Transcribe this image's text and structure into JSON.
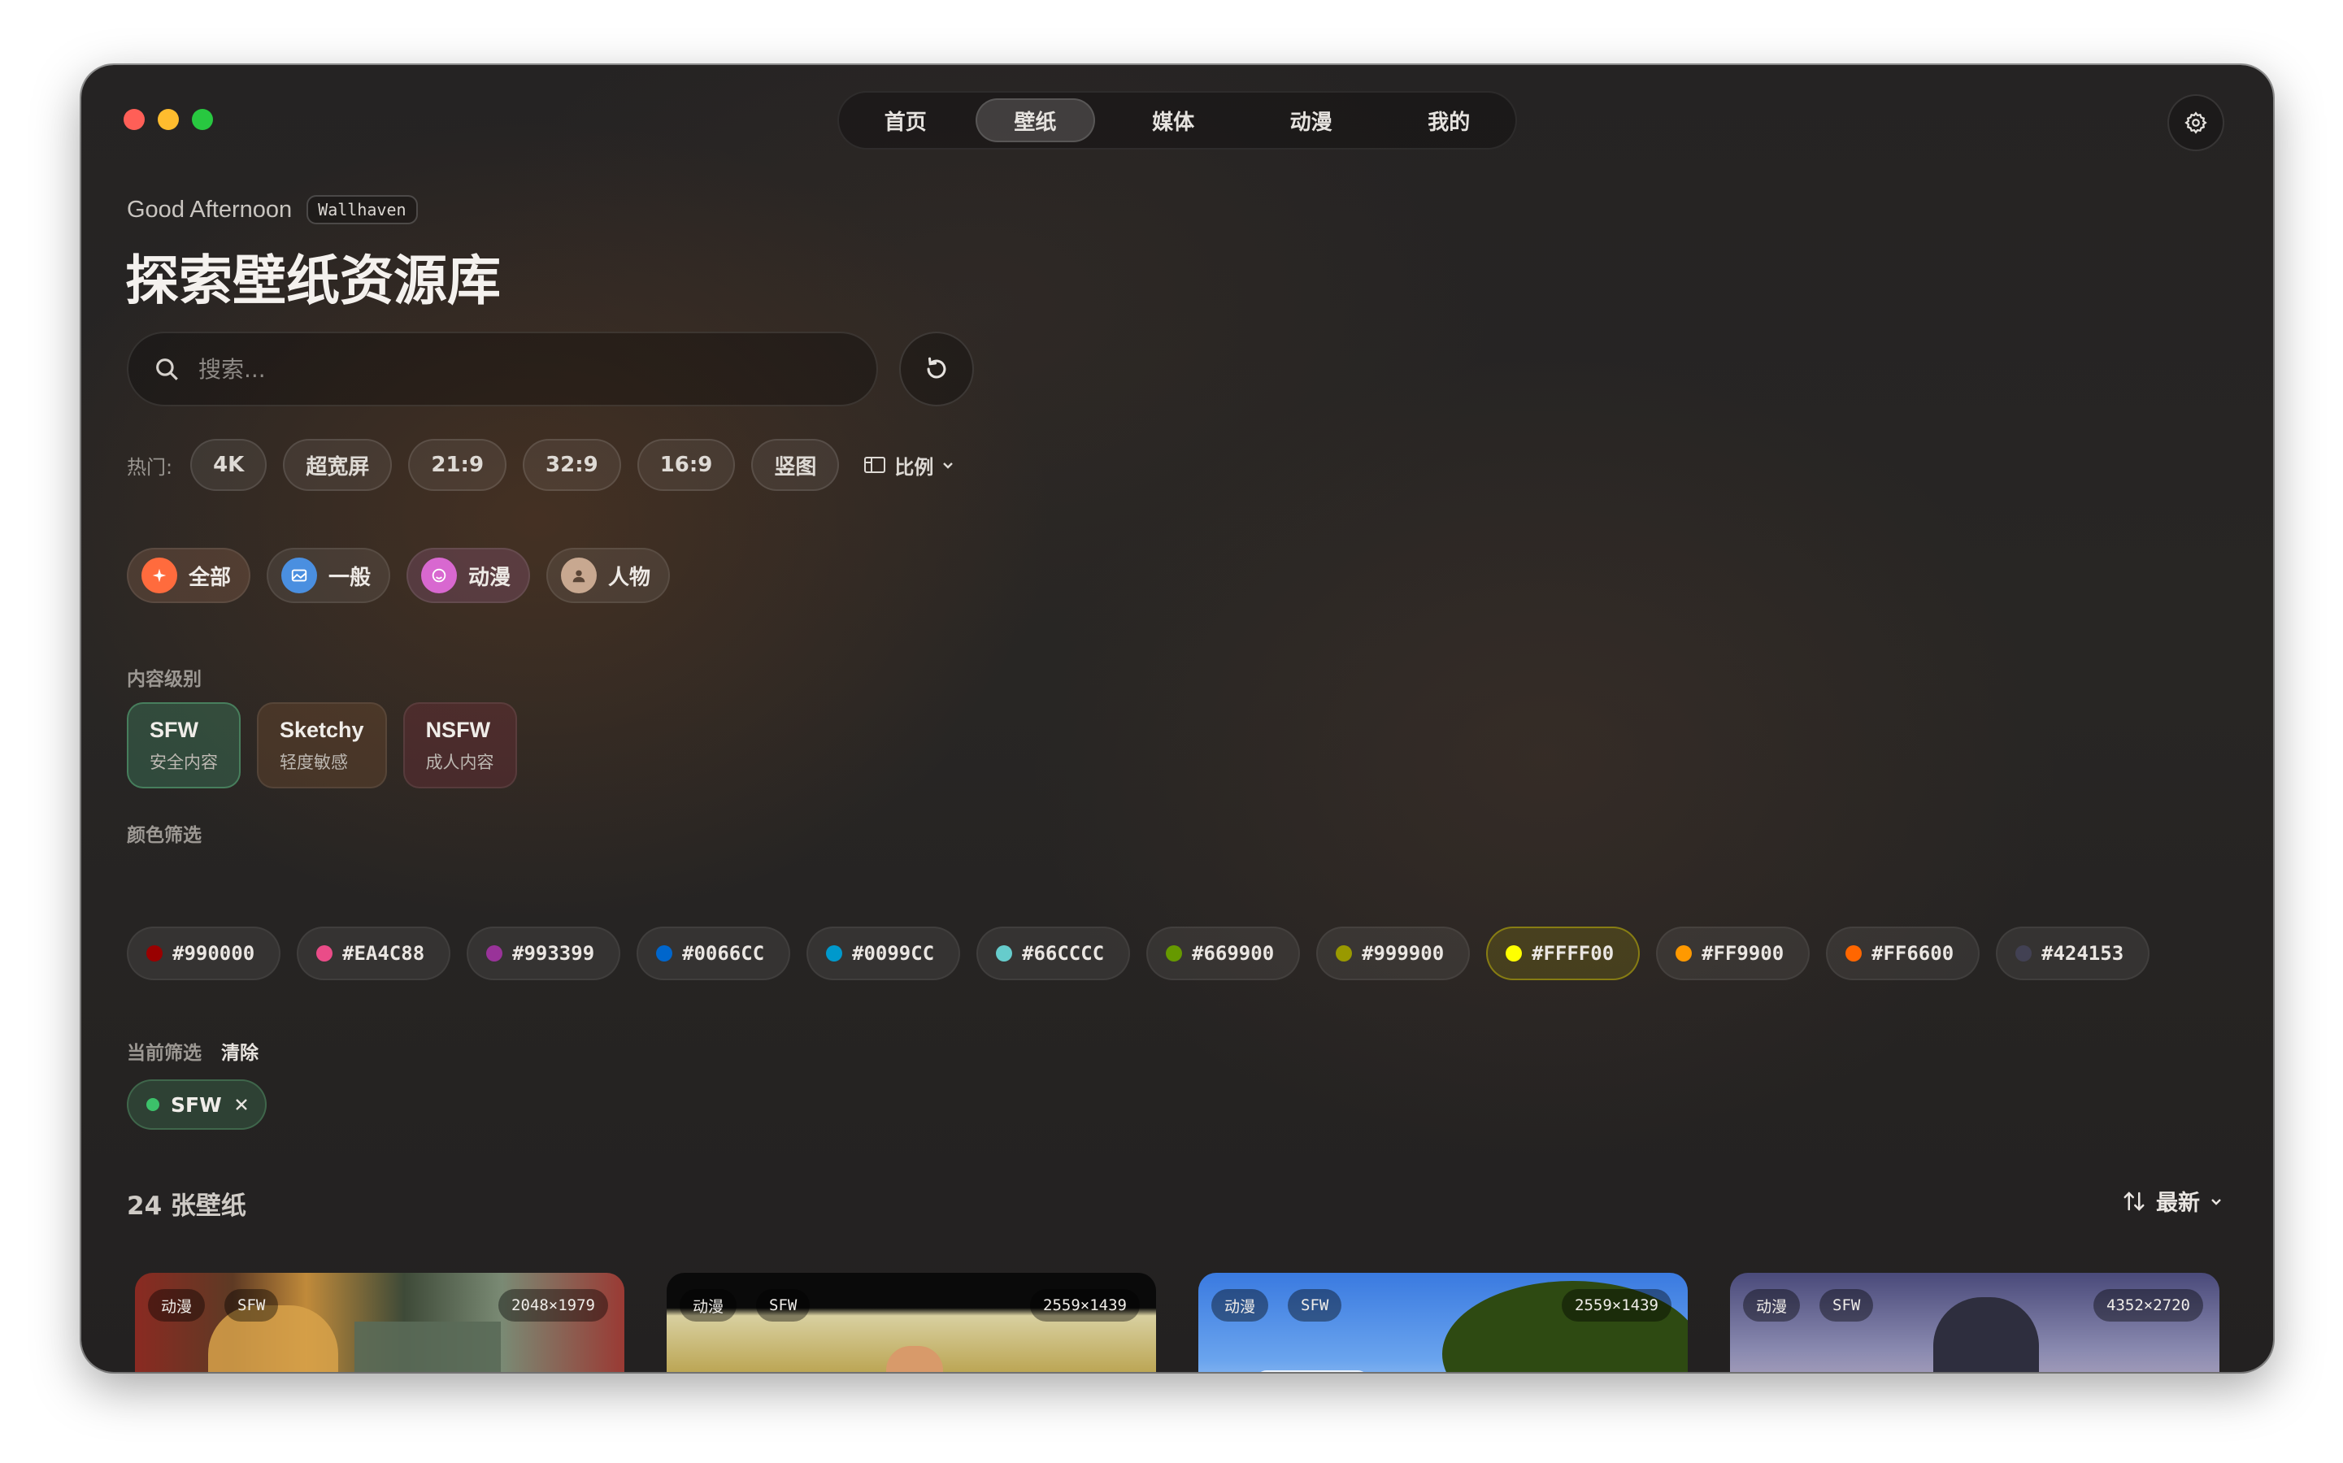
{
  "nav": {
    "tabs": [
      {
        "label": "首页"
      },
      {
        "label": "壁纸"
      },
      {
        "label": "媒体"
      },
      {
        "label": "动漫"
      },
      {
        "label": "我的"
      }
    ],
    "active": "壁纸"
  },
  "header": {
    "greeting": "Good Afternoon",
    "source_badge": "Wallhaven",
    "title": "探索壁纸资源库"
  },
  "search": {
    "placeholder": "搜索..."
  },
  "hot": {
    "label": "热门:",
    "tags": [
      "4K",
      "超宽屏",
      "21:9",
      "32:9",
      "16:9",
      "竖图"
    ],
    "ratio_label": "比例"
  },
  "categories": [
    {
      "label": "全部",
      "icon": "sparkle-icon",
      "color": "#ff6b3d"
    },
    {
      "label": "一般",
      "icon": "image-icon",
      "color": "#4a8fe0"
    },
    {
      "label": "动漫",
      "icon": "smile-icon",
      "color": "#d868d0"
    },
    {
      "label": "人物",
      "icon": "person-icon",
      "color": "#c8a890"
    }
  ],
  "content_level": {
    "label": "内容级别",
    "levels": [
      {
        "title": "SFW",
        "subtitle": "安全内容"
      },
      {
        "title": "Sketchy",
        "subtitle": "轻度敏感"
      },
      {
        "title": "NSFW",
        "subtitle": "成人内容"
      }
    ]
  },
  "color_filter": {
    "label": "颜色筛选",
    "colors": [
      {
        "label": "#990000",
        "hex": "#990000"
      },
      {
        "label": "#EA4C88",
        "hex": "#EA4C88"
      },
      {
        "label": "#993399",
        "hex": "#993399"
      },
      {
        "label": "#0066CC",
        "hex": "#0066CC"
      },
      {
        "label": "#0099CC",
        "hex": "#0099CC"
      },
      {
        "label": "#66CCCC",
        "hex": "#66CCCC"
      },
      {
        "label": "#669900",
        "hex": "#669900"
      },
      {
        "label": "#999900",
        "hex": "#999900"
      },
      {
        "label": "#FFFF00",
        "hex": "#FFFF00"
      },
      {
        "label": "#FF9900",
        "hex": "#FF9900"
      },
      {
        "label": "#FF6600",
        "hex": "#FF6600"
      },
      {
        "label": "#424153",
        "hex": "#424153"
      }
    ]
  },
  "current_filter": {
    "label": "当前筛选",
    "clear_label": "清除",
    "active": "SFW"
  },
  "results": {
    "count_label": "24 张壁纸",
    "sort_label": "最新"
  },
  "wallpapers": [
    {
      "category": "动漫",
      "purity": "SFW",
      "resolution": "2048×1979"
    },
    {
      "category": "动漫",
      "purity": "SFW",
      "resolution": "2559×1439"
    },
    {
      "category": "动漫",
      "purity": "SFW",
      "resolution": "2559×1439"
    },
    {
      "category": "动漫",
      "purity": "SFW",
      "resolution": "4352×2720"
    }
  ]
}
